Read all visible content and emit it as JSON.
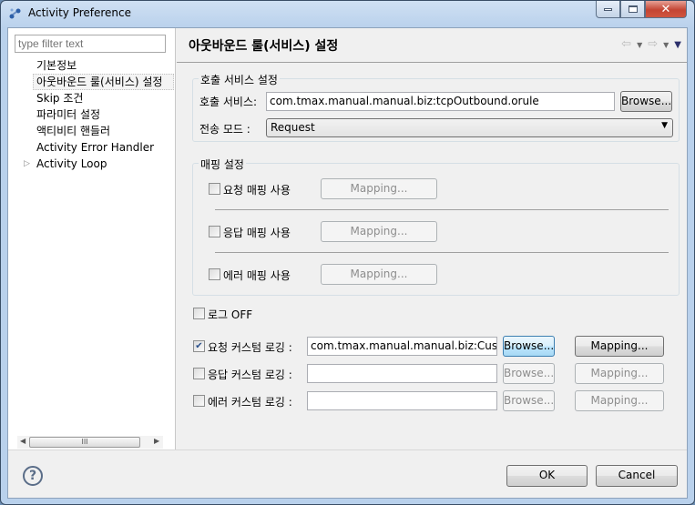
{
  "window": {
    "title": "Activity Preference",
    "icon": "app-icon",
    "controls": [
      "minimize",
      "maximize",
      "close"
    ]
  },
  "sidebar": {
    "filter_placeholder": "type filter text",
    "items": [
      {
        "label": "기본정보"
      },
      {
        "label": "아웃바운드 룰(서비스) 설정",
        "selected": true
      },
      {
        "label": "Skip 조건"
      },
      {
        "label": "파라미터 설정"
      },
      {
        "label": "액티비티 핸들러"
      },
      {
        "label": "Activity Error Handler"
      },
      {
        "label": "Activity Loop",
        "expandable": true
      }
    ],
    "scroll_thumb": "III"
  },
  "page": {
    "title": "아웃바운드 룰(서비스) 설정",
    "nav": {
      "back": "⇦",
      "forward": "⇨",
      "menu": "▼"
    }
  },
  "service_group": {
    "label": "호출 서비스 설정",
    "service_label": "호출 서비스:",
    "service_value": "com.tmax.manual.manual.biz:tcpOutbound.orule",
    "browse_label": "Browse...",
    "mode_label": "전송 모드 :",
    "mode_value": "Request"
  },
  "mapping_group": {
    "label": "매핑 설정",
    "rows": [
      {
        "label": "요청 매핑 사용",
        "checked": false,
        "button": "Mapping..."
      },
      {
        "label": "응답 매핑 사용",
        "checked": false,
        "button": "Mapping..."
      },
      {
        "label": "에러 매핑 사용",
        "checked": false,
        "button": "Mapping..."
      }
    ]
  },
  "log_off": {
    "label": "로그 OFF",
    "checked": false
  },
  "custom_logging": [
    {
      "label": "요청 커스텀 로깅 :",
      "checked": true,
      "value": "com.tmax.manual.manual.biz:Custom",
      "browse": "Browse...",
      "mapping": "Mapping..."
    },
    {
      "label": "응답 커스텀 로깅 :",
      "checked": false,
      "value": "",
      "browse": "Browse...",
      "mapping": "Mapping..."
    },
    {
      "label": "에러 커스텀 로깅 :",
      "checked": false,
      "value": "",
      "browse": "Browse...",
      "mapping": "Mapping..."
    }
  ],
  "footer": {
    "ok": "OK",
    "cancel": "Cancel",
    "help_icon": "?"
  }
}
